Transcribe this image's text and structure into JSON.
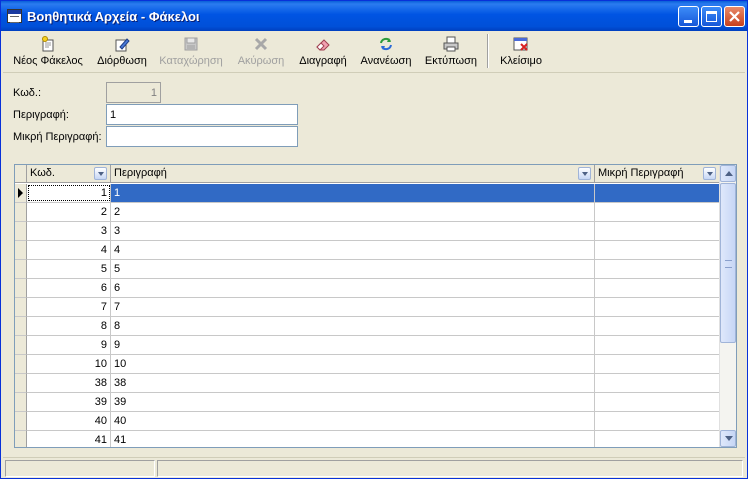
{
  "window": {
    "title": "Βοηθητικά Αρχεία - Φάκελοι",
    "title_color": "#0054e3"
  },
  "toolbar": {
    "new_label": "Νέος Φάκελος",
    "edit_label": "Διόρθωση",
    "save_label": "Καταχώρηση",
    "cancel_label": "Ακύρωση",
    "delete_label": "Διαγραφή",
    "refresh_label": "Ανανέωση",
    "print_label": "Εκτύπωση",
    "close_label": "Κλείσιμο"
  },
  "form": {
    "code_label": "Κωδ.:",
    "code_value": "1",
    "description_label": "Περιγραφή:",
    "description_value": "1",
    "short_description_label": "Μικρή Περιγραφή:",
    "short_description_value": ""
  },
  "grid": {
    "columns": [
      "Κωδ.",
      "Περιγραφή",
      "Μικρή Περιγραφή"
    ],
    "rows": [
      {
        "code": "1",
        "description": "1",
        "short": ""
      },
      {
        "code": "2",
        "description": "2",
        "short": ""
      },
      {
        "code": "3",
        "description": "3",
        "short": ""
      },
      {
        "code": "4",
        "description": "4",
        "short": ""
      },
      {
        "code": "5",
        "description": "5",
        "short": ""
      },
      {
        "code": "6",
        "description": "6",
        "short": ""
      },
      {
        "code": "7",
        "description": "7",
        "short": ""
      },
      {
        "code": "8",
        "description": "8",
        "short": ""
      },
      {
        "code": "9",
        "description": "9",
        "short": ""
      },
      {
        "code": "10",
        "description": "10",
        "short": ""
      },
      {
        "code": "38",
        "description": "38",
        "short": ""
      },
      {
        "code": "39",
        "description": "39",
        "short": ""
      },
      {
        "code": "40",
        "description": "40",
        "short": ""
      },
      {
        "code": "41",
        "description": "41",
        "short": ""
      }
    ],
    "selected_row": 0,
    "selection_color": "#316ac5"
  }
}
